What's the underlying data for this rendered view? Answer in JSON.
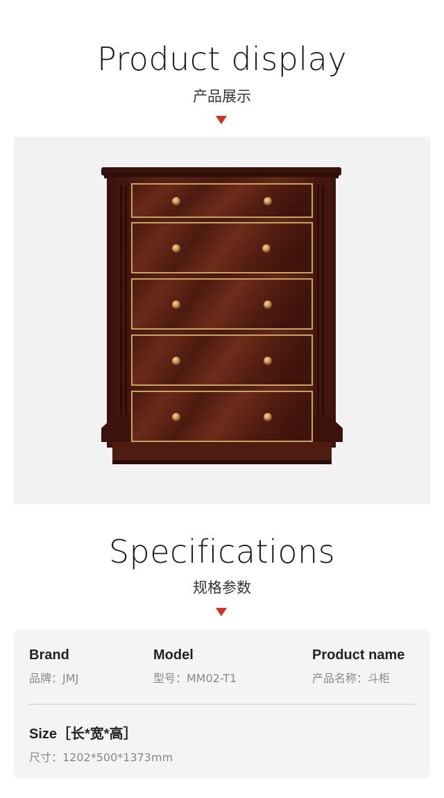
{
  "display": {
    "title": "Product display",
    "subtitle": "产品展示"
  },
  "specifications": {
    "title": "Specifications",
    "subtitle": "规格参数",
    "brand": {
      "label": "Brand",
      "value": "品牌：JMJ"
    },
    "model": {
      "label": "Model",
      "value": "型号：MM02-T1"
    },
    "product_name": {
      "label": "Product name",
      "value": "产品名称：斗柜"
    },
    "size": {
      "label": "Size［长*宽*高］",
      "value": "尺寸：1202*500*1373mm"
    }
  },
  "colors": {
    "accent_arrow": "#d8301b",
    "wood": "#4a1a12",
    "gold_trim": "#c9a45c",
    "panel_bg": "#f2f2f2"
  }
}
